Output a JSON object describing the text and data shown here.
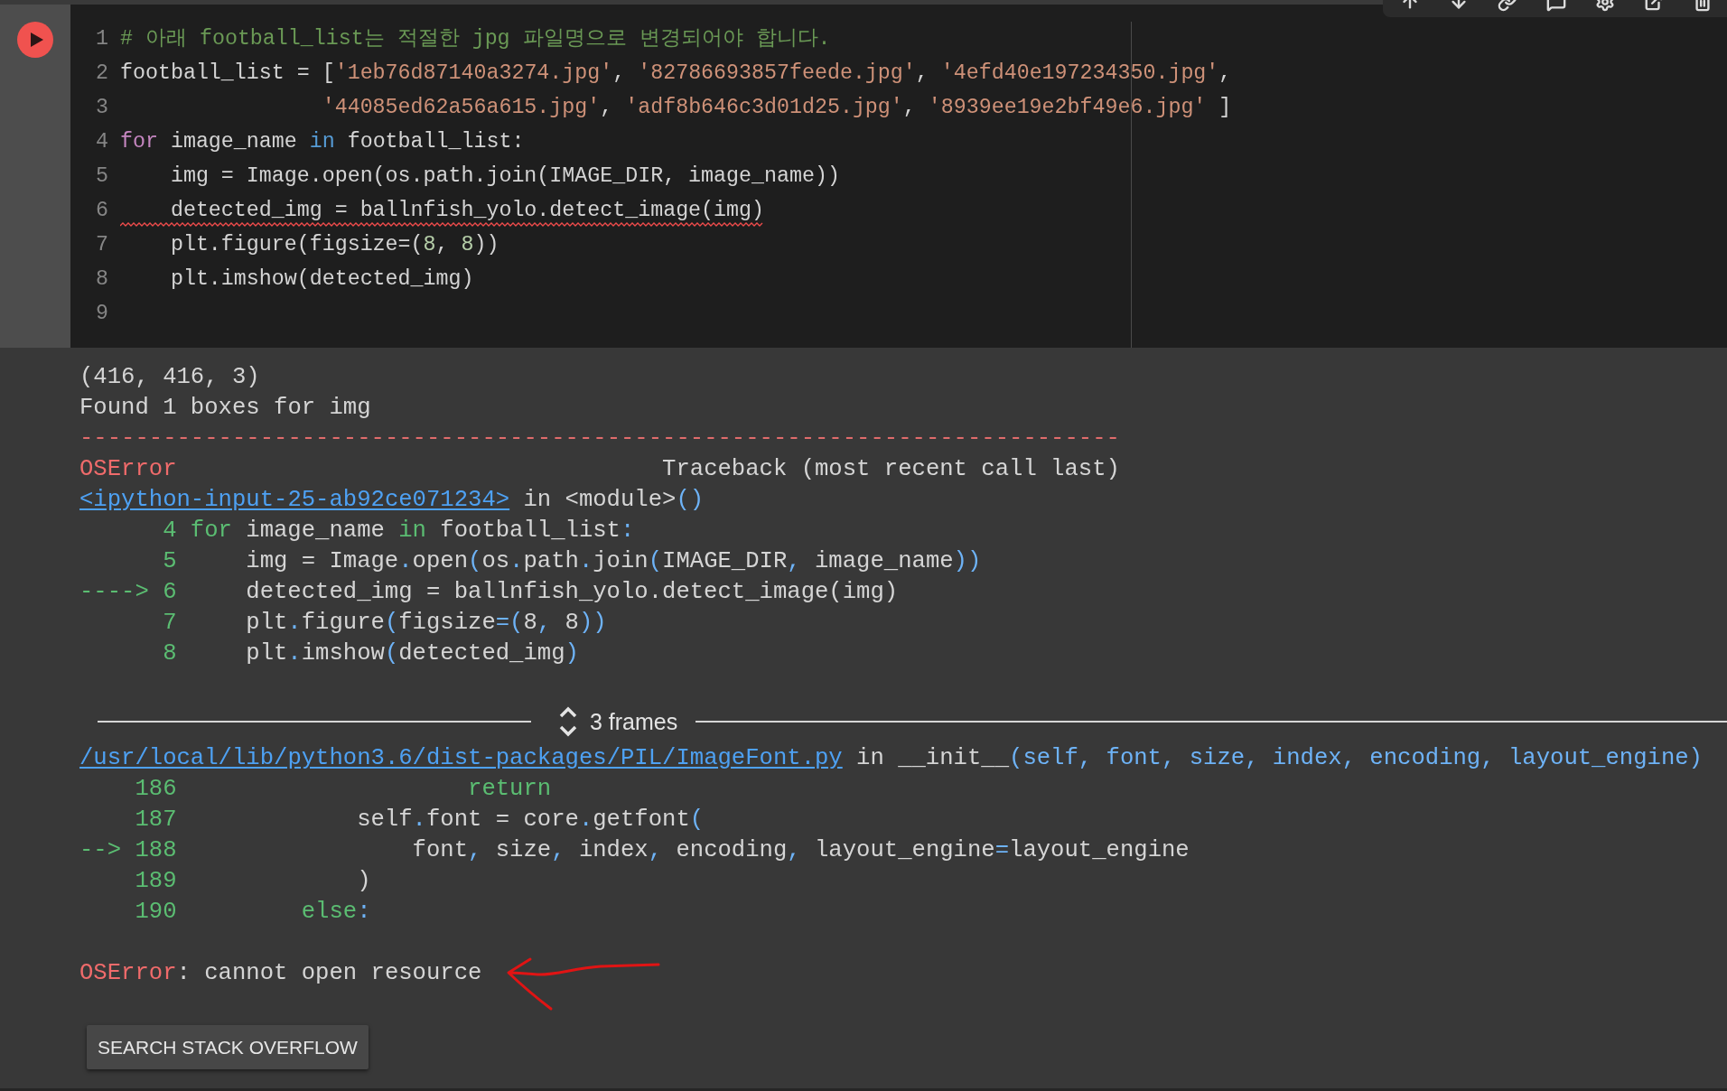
{
  "code_lines": [
    {
      "number": "1",
      "error": false,
      "tokens": [
        {
          "kind": "comment",
          "text": "# 아래 football_list는 적절한 jpg 파일명으로 변경되어야 합니다."
        }
      ]
    },
    {
      "number": "2",
      "error": false,
      "tokens": [
        {
          "kind": "plain",
          "text": "football_list = ["
        },
        {
          "kind": "string",
          "text": "'1eb76d87140a3274.jpg'"
        },
        {
          "kind": "plain",
          "text": ", "
        },
        {
          "kind": "string",
          "text": "'82786693857feede.jpg'"
        },
        {
          "kind": "plain",
          "text": ", "
        },
        {
          "kind": "string",
          "text": "'4efd40e197234350.jpg'"
        },
        {
          "kind": "plain",
          "text": ","
        }
      ]
    },
    {
      "number": "3",
      "error": false,
      "tokens": [
        {
          "kind": "string",
          "text": "                '44085ed62a56a615.jpg'"
        },
        {
          "kind": "plain",
          "text": ", "
        },
        {
          "kind": "string",
          "text": "'adf8b646c3d01d25.jpg'"
        },
        {
          "kind": "plain",
          "text": ", "
        },
        {
          "kind": "string",
          "text": "'8939ee19e2bf49e6.jpg'"
        },
        {
          "kind": "plain",
          "text": " ]"
        }
      ]
    },
    {
      "number": "4",
      "error": false,
      "tokens": [
        {
          "kind": "control",
          "text": "for"
        },
        {
          "kind": "plain",
          "text": " image_name "
        },
        {
          "kind": "keyword",
          "text": "in"
        },
        {
          "kind": "plain",
          "text": " football_list:"
        }
      ]
    },
    {
      "number": "5",
      "error": false,
      "tokens": [
        {
          "kind": "plain",
          "text": "    img = Image.open(os.path.join(IMAGE_DIR, image_name))"
        }
      ]
    },
    {
      "number": "6",
      "error": true,
      "tokens": [
        {
          "kind": "plain",
          "text": "    detected_img = ballnfish_yolo.detect_image(img)"
        }
      ]
    },
    {
      "number": "7",
      "error": false,
      "tokens": [
        {
          "kind": "plain",
          "text": "    plt.figure(figsize=("
        },
        {
          "kind": "number",
          "text": "8"
        },
        {
          "kind": "plain",
          "text": ", "
        },
        {
          "kind": "number",
          "text": "8"
        },
        {
          "kind": "plain",
          "text": "))"
        }
      ]
    },
    {
      "number": "8",
      "error": false,
      "tokens": [
        {
          "kind": "plain",
          "text": "    plt.imshow(detected_img)"
        }
      ]
    },
    {
      "number": "9",
      "error": false
    }
  ],
  "output": {
    "stdout": [
      "(416, 416, 3)",
      "Found 1 boxes for img"
    ],
    "traceback": {
      "separator": "---------------------------------------------------------------------------",
      "error_type": "OSError",
      "header": "Traceback (most recent call last)",
      "blocks": [
        {
          "kind": "frame",
          "file": "<ipython-input-25-ab92ce071234>",
          "location": [
            {
              "kind": "plain",
              "text": "in <module>"
            },
            {
              "kind": "punct",
              "text": "()"
            }
          ],
          "lines": [
            {
              "number": "4",
              "tokens": [
                {
                  "kind": "keyword",
                  "text": "for"
                },
                {
                  "kind": "plain",
                  "text": " image_name "
                },
                {
                  "kind": "keyword",
                  "text": "in"
                },
                {
                  "kind": "plain",
                  "text": " football_list"
                },
                {
                  "kind": "punct",
                  "text": ":"
                }
              ]
            },
            {
              "number": "5",
              "tokens": [
                {
                  "kind": "plain",
                  "text": "    img = Image"
                },
                {
                  "kind": "punct",
                  "text": "."
                },
                {
                  "kind": "plain",
                  "text": "open"
                },
                {
                  "kind": "punct",
                  "text": "("
                },
                {
                  "kind": "plain",
                  "text": "os"
                },
                {
                  "kind": "punct",
                  "text": "."
                },
                {
                  "kind": "plain",
                  "text": "path"
                },
                {
                  "kind": "punct",
                  "text": "."
                },
                {
                  "kind": "plain",
                  "text": "join"
                },
                {
                  "kind": "punct",
                  "text": "("
                },
                {
                  "kind": "plain",
                  "text": "IMAGE_DIR"
                },
                {
                  "kind": "punct",
                  "text": ","
                },
                {
                  "kind": "plain",
                  "text": " image_name"
                },
                {
                  "kind": "punct",
                  "text": "))"
                }
              ]
            },
            {
              "arrow": "---->",
              "number": "6",
              "tokens": [
                {
                  "kind": "plain",
                  "text": "    detected_img = ballnfish_yolo.detect_image(img)"
                }
              ]
            },
            {
              "number": "7",
              "tokens": [
                {
                  "kind": "plain",
                  "text": "    plt"
                },
                {
                  "kind": "punct",
                  "text": "."
                },
                {
                  "kind": "plain",
                  "text": "figure"
                },
                {
                  "kind": "punct",
                  "text": "("
                },
                {
                  "kind": "plain",
                  "text": "figsize"
                },
                {
                  "kind": "punct",
                  "text": "=("
                },
                {
                  "kind": "plain",
                  "text": "8"
                },
                {
                  "kind": "punct",
                  "text": ","
                },
                {
                  "kind": "plain",
                  "text": " 8"
                },
                {
                  "kind": "punct",
                  "text": "))"
                }
              ]
            },
            {
              "number": "8",
              "tokens": [
                {
                  "kind": "plain",
                  "text": "    plt"
                },
                {
                  "kind": "punct",
                  "text": "."
                },
                {
                  "kind": "plain",
                  "text": "imshow"
                },
                {
                  "kind": "punct",
                  "text": "("
                },
                {
                  "kind": "plain",
                  "text": "detected_img"
                },
                {
                  "kind": "punct",
                  "text": ")"
                }
              ]
            }
          ]
        },
        {
          "kind": "collapsed",
          "label": "3 frames"
        },
        {
          "kind": "frame",
          "file": "/usr/local/lib/python3.6/dist-packages/PIL/ImageFont.py",
          "location": [
            {
              "kind": "plain",
              "text": "in __init__"
            },
            {
              "kind": "punct",
              "text": "(self, font, size, index, encoding, layout_engine)"
            }
          ],
          "lines": [
            {
              "number": "186",
              "tokens": [
                {
                  "kind": "keyword",
                  "text": "                    return"
                }
              ]
            },
            {
              "number": "187",
              "tokens": [
                {
                  "kind": "plain",
                  "text": "            self"
                },
                {
                  "kind": "punct",
                  "text": "."
                },
                {
                  "kind": "plain",
                  "text": "font = core"
                },
                {
                  "kind": "punct",
                  "text": "."
                },
                {
                  "kind": "plain",
                  "text": "getfont"
                },
                {
                  "kind": "punct",
                  "text": "("
                }
              ]
            },
            {
              "arrow": "-->",
              "number": "188",
              "tokens": [
                {
                  "kind": "plain",
                  "text": "                font"
                },
                {
                  "kind": "punct",
                  "text": ","
                },
                {
                  "kind": "plain",
                  "text": " size"
                },
                {
                  "kind": "punct",
                  "text": ","
                },
                {
                  "kind": "plain",
                  "text": " index"
                },
                {
                  "kind": "punct",
                  "text": ","
                },
                {
                  "kind": "plain",
                  "text": " encoding"
                },
                {
                  "kind": "punct",
                  "text": ","
                },
                {
                  "kind": "plain",
                  "text": " layout_engine"
                },
                {
                  "kind": "punct",
                  "text": "="
                },
                {
                  "kind": "plain",
                  "text": "layout_engine"
                }
              ]
            },
            {
              "number": "189",
              "tokens": [
                {
                  "kind": "plain",
                  "text": "            )"
                }
              ]
            },
            {
              "number": "190",
              "tokens": [
                {
                  "kind": "keyword",
                  "text": "        else"
                },
                {
                  "kind": "punct",
                  "text": ":"
                }
              ]
            }
          ]
        }
      ],
      "message": [
        {
          "kind": "error",
          "text": "OSError"
        },
        {
          "kind": "plain",
          "text": ": cannot open resource"
        }
      ]
    }
  },
  "search_button": "SEARCH STACK OVERFLOW"
}
